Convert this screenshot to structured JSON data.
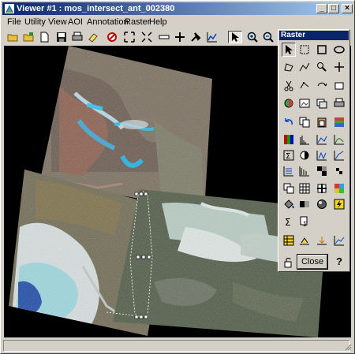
{
  "window": {
    "title": "Viewer #1 : mos_intersect_ant_002380",
    "minimize": "_",
    "maximize": "□",
    "close": "×"
  },
  "menubar": [
    "File",
    "Utility",
    "View",
    "AOI",
    "Annotation",
    "Raster",
    "Help"
  ],
  "toolbar_icons": [
    "open-folder-icon",
    "open-layer-icon",
    "new-icon",
    "save-icon",
    "print-icon",
    "eraser-icon",
    "clear-icon",
    "zoom-fit-icon",
    "scale-icon",
    "ruler-icon",
    "crosshair-icon",
    "pick-icon",
    "profile-icon",
    "select-arrow-icon",
    "zoom-in-icon",
    "zoom-out-icon"
  ],
  "palette": {
    "title": "Raster",
    "close_label": "Close",
    "help_label": "?"
  },
  "colors": {
    "titlebar_start": "#0a246a",
    "titlebar_end": "#a6caf0",
    "face": "#d4d0c8",
    "viewer_bg": "#000000"
  }
}
